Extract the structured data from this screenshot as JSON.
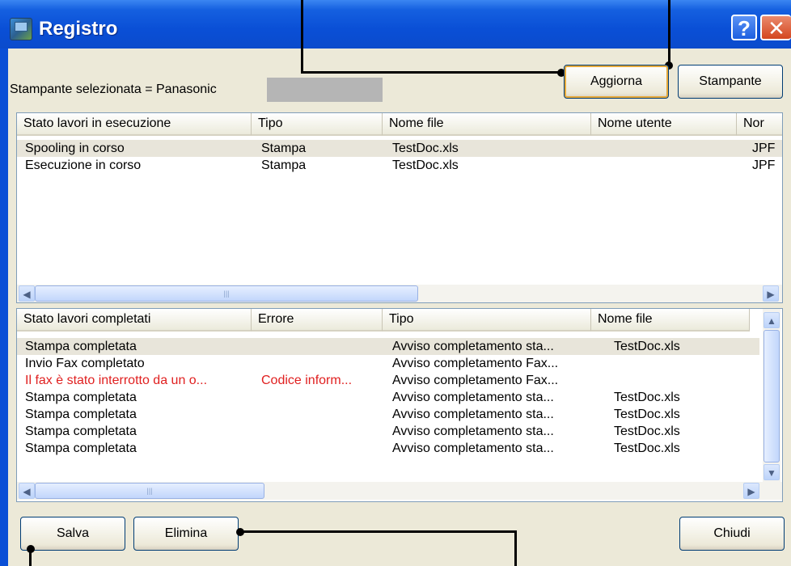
{
  "window": {
    "title": "Registro",
    "help_label": "?",
    "close_label": "✕"
  },
  "top": {
    "printer_label": "Stampante selezionata = Panasonic",
    "refresh_label": "Aggiorna",
    "printer_button_label": "Stampante"
  },
  "running": {
    "columns": [
      "Stato lavori in esecuzione",
      "Tipo",
      "Nome file",
      "Nome utente",
      "Nor"
    ],
    "rows": [
      [
        "Spooling in corso",
        "Stampa",
        "TestDoc.xls",
        "",
        "JPF"
      ],
      [
        "Esecuzione in corso",
        "Stampa",
        "TestDoc.xls",
        "",
        "JPF"
      ]
    ]
  },
  "completed": {
    "columns": [
      "Stato lavori completati",
      "Errore",
      "Tipo",
      "Nome file"
    ],
    "rows": [
      [
        "Stampa completata",
        "",
        "Avviso completamento sta...",
        "TestDoc.xls"
      ],
      [
        "Invio Fax completato",
        "",
        "Avviso completamento Fax...",
        ""
      ],
      [
        "Il fax è stato interrotto da un o...",
        "Codice inform...",
        "Avviso completamento Fax...",
        ""
      ],
      [
        "Stampa completata",
        "",
        "Avviso completamento sta...",
        "TestDoc.xls"
      ],
      [
        "Stampa completata",
        "",
        "Avviso completamento sta...",
        "TestDoc.xls"
      ],
      [
        "Stampa completata",
        "",
        "Avviso completamento sta...",
        "TestDoc.xls"
      ],
      [
        "Stampa completata",
        "",
        "Avviso completamento sta...",
        "TestDoc.xls"
      ]
    ]
  },
  "footer": {
    "save_label": "Salva",
    "delete_label": "Elimina",
    "close_label": "Chiudi"
  },
  "icons": {
    "scroll_left": "◀",
    "scroll_right": "▶",
    "scroll_up": "▲",
    "scroll_down": "▼",
    "grip": "|||"
  },
  "colors": {
    "titlebar": "#0a4fd6",
    "client": "#ece9d8",
    "error_text": "#e02020",
    "selected_row": "#e8e5da"
  }
}
